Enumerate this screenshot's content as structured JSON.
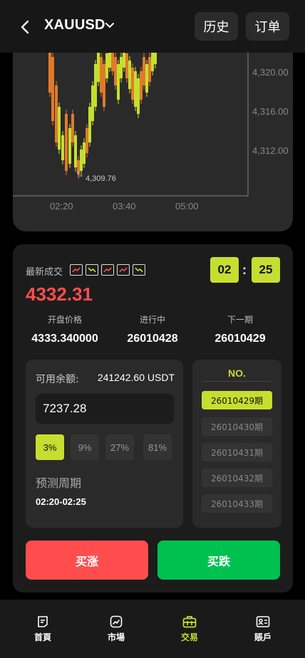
{
  "header": {
    "symbol": "XAUUSD",
    "history_label": "历史",
    "orders_label": "订单"
  },
  "chart": {
    "price_ticks": [
      "4,320.00",
      "4,316.00",
      "4,312.00"
    ],
    "time_ticks": [
      "02:20",
      "03:40",
      "05:00"
    ],
    "low_marker": "4,309.76",
    "up_color": "#c6de2f",
    "down_color": "#e07a2a"
  },
  "trade": {
    "latest_label": "最新成交",
    "recent_trend": [
      "up",
      "down",
      "up",
      "up",
      "down"
    ],
    "price": "4332.31",
    "timer_min": "02",
    "timer_sec": "25",
    "open_price_label": "开盘价格",
    "open_price": "4333.340000",
    "in_progress_label": "进行中",
    "in_progress": "26010428",
    "next_label": "下一期",
    "next": "26010429",
    "balance_label": "可用余额:",
    "balance": "241242.60 USDT",
    "amount": "7237.28",
    "percents": [
      "3%",
      "9%",
      "27%",
      "81%"
    ],
    "period_label": "预测周期",
    "period_value": "02:20-02:25",
    "no_title": "NO.",
    "periods": [
      "26010429期",
      "26010430期",
      "26010431期",
      "26010432期",
      "26010433期"
    ],
    "buy_up": "买涨",
    "buy_down": "买跌"
  },
  "nav": {
    "items": [
      {
        "label": "首頁",
        "icon": "home-icon"
      },
      {
        "label": "市場",
        "icon": "market-icon"
      },
      {
        "label": "交易",
        "icon": "trade-icon"
      },
      {
        "label": "賬戶",
        "icon": "account-icon"
      }
    ]
  },
  "colors": {
    "accent": "#c6de2f",
    "up_red": "#ff4d4d",
    "down_green": "#00c150"
  }
}
